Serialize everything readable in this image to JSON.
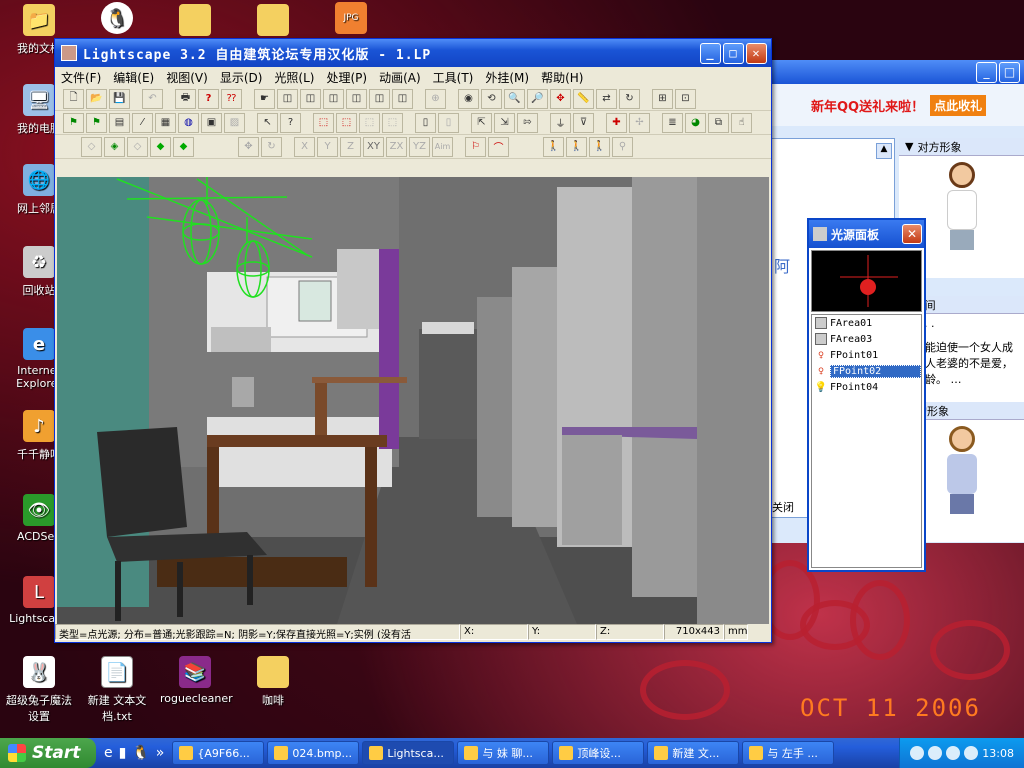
{
  "wallpaper": {
    "date_stamp": "OCT 11 2006"
  },
  "desktop_icons": [
    {
      "label": "我的文档",
      "icon": "folder-documents-icon"
    },
    {
      "label": "",
      "icon": "qq-penguin-icon"
    },
    {
      "label": "",
      "icon": "folder-icon"
    },
    {
      "label": "",
      "icon": "folder-icon"
    },
    {
      "label": "",
      "icon": "jpg-file-icon"
    },
    {
      "label": "我的电脑",
      "icon": "computer-icon"
    },
    {
      "label": "网上邻居",
      "icon": "network-icon"
    },
    {
      "label": "回收站",
      "icon": "recycle-bin-icon"
    },
    {
      "label": "Internet Explorer",
      "icon": "ie-icon"
    },
    {
      "label": "千千静听",
      "icon": "music-player-icon"
    },
    {
      "label": "ACDSee",
      "icon": "acdsee-icon"
    },
    {
      "label": "Lightscape",
      "icon": "lightscape-icon"
    },
    {
      "label": "超级兔子魔法设置",
      "icon": "rabbit-icon"
    },
    {
      "label": "新建 文本文档.txt",
      "icon": "text-file-icon"
    },
    {
      "label": "roguecleaner",
      "icon": "winrar-icon"
    },
    {
      "label": "咖啡",
      "icon": "folder-icon"
    }
  ],
  "main_window": {
    "title": "Lightscape 3.2 自由建筑论坛专用汉化版  - 1.LP",
    "menu": [
      "文件(F)",
      "编辑(E)",
      "视图(V)",
      "显示(D)",
      "光照(L)",
      "处理(P)",
      "动画(A)",
      "工具(T)",
      "外挂(M)",
      "帮助(H)"
    ],
    "toolbar_row3_labels": [
      "X",
      "Y",
      "Z",
      "XY",
      "ZX",
      "YZ",
      "Aim"
    ],
    "status": {
      "info": "类型=点光源; 分布=普通;光影跟踪=N; 阴影=Y;保存直接光照=Y;实例 (没有活",
      "x_label": "X:",
      "y_label": "Y:",
      "z_label": "Z:",
      "size": "710x443",
      "unit": "mm"
    }
  },
  "light_panel": {
    "title": "光源面板",
    "items": [
      {
        "name": "FArea01",
        "icon": "area-light-icon",
        "selected": false
      },
      {
        "name": "FArea03",
        "icon": "area-light-icon",
        "selected": false
      },
      {
        "name": "FPoint01",
        "icon": "point-light-icon",
        "selected": false
      },
      {
        "name": "FPoint02",
        "icon": "point-light-icon",
        "selected": true
      },
      {
        "name": "FPoint04",
        "icon": "bulb-icon",
        "selected": false
      }
    ]
  },
  "qq_window": {
    "banner_text": "新年QQ送礼来啦！",
    "banner_link": "点此收礼",
    "peer_header": "对方形象",
    "qzone_label": "Q空间",
    "qzone_dots": "· · · · ·",
    "qzone_text": "真正能迫使一个女人成为别人老婆的不是爱，是年龄。 …",
    "peer_side_char": "阿",
    "my_header": "我的形象",
    "close_label": "关闭"
  },
  "taskbar": {
    "start_label": "Start",
    "tasks": [
      {
        "label": "{A9F66...",
        "active": false
      },
      {
        "label": "024.bmp...",
        "active": false
      },
      {
        "label": "Lightsca...",
        "active": true
      },
      {
        "label": "与 妹 聊...",
        "active": false
      },
      {
        "label": "顶峰设...",
        "active": false
      },
      {
        "label": "新建 文...",
        "active": false
      },
      {
        "label": "与 左手 ...",
        "active": false
      }
    ],
    "clock": "13:08"
  }
}
